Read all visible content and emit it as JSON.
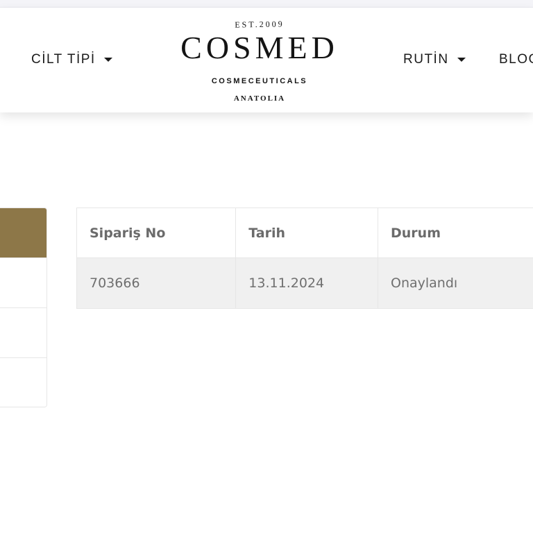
{
  "nav": {
    "left_item": "CİLT TİPİ",
    "right_item_1": "RUTİN",
    "right_item_2": "BLOG"
  },
  "logo": {
    "est": "EST.2009",
    "brand": "COSMED",
    "tagline": "COSMECEUTICALS",
    "region": "ANATOLIA"
  },
  "orders": {
    "headers": [
      "Sipariş No",
      "Tarih",
      "Durum"
    ],
    "rows": [
      [
        "703666",
        "13.11.2024",
        "Onaylandı"
      ]
    ]
  },
  "colors": {
    "accent": "#8d7748",
    "row_bg": "#f0f0f0"
  }
}
